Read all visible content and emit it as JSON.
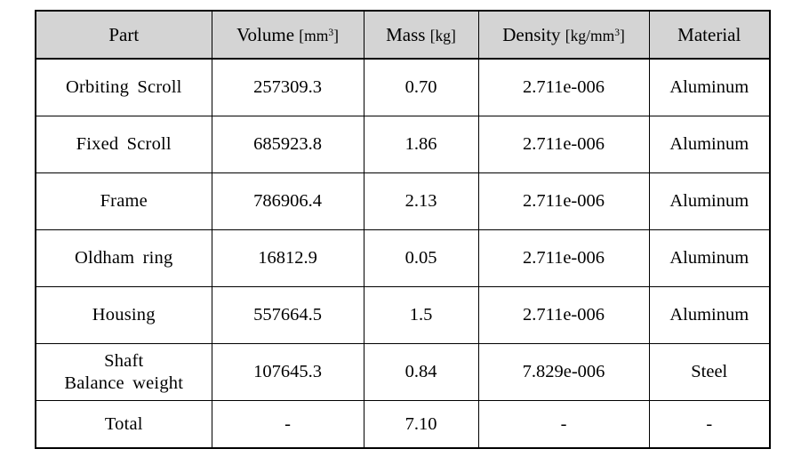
{
  "table": {
    "columns": [
      {
        "id": "part",
        "label": "Part",
        "unit": ""
      },
      {
        "id": "volume",
        "label": "Volume",
        "unit": "[mm³]"
      },
      {
        "id": "mass",
        "label": "Mass",
        "unit": "[kg]"
      },
      {
        "id": "density",
        "label": "Density",
        "unit": "[kg/mm³]"
      },
      {
        "id": "material",
        "label": "Material",
        "unit": ""
      }
    ],
    "header": {
      "part": "Part",
      "volume_label": "Volume",
      "volume_unit_open": "[",
      "volume_unit_base": "mm",
      "volume_unit_exp": "3",
      "volume_unit_close": "]",
      "mass_label": "Mass",
      "mass_unit": "[kg]",
      "density_label": "Density",
      "density_unit_open": "[kg/",
      "density_unit_base": "mm",
      "density_unit_exp": "3",
      "density_unit_close": "]",
      "material": "Material"
    },
    "rows": [
      {
        "part": "Orbiting  Scroll",
        "volume": "257309.3",
        "mass": "0.70",
        "density": "2.711e-006",
        "material": "Aluminum"
      },
      {
        "part": "Fixed  Scroll",
        "volume": "685923.8",
        "mass": "1.86",
        "density": "2.711e-006",
        "material": "Aluminum"
      },
      {
        "part": "Frame",
        "volume": "786906.4",
        "mass": "2.13",
        "density": "2.711e-006",
        "material": "Aluminum"
      },
      {
        "part": "Oldham  ring",
        "volume": "16812.9",
        "mass": "0.05",
        "density": "2.711e-006",
        "material": "Aluminum"
      },
      {
        "part": "Housing",
        "volume": "557664.5",
        "mass": "1.5",
        "density": "2.711e-006",
        "material": "Aluminum"
      },
      {
        "part_line1": "Shaft",
        "part_line2": "Balance  weight",
        "volume": "107645.3",
        "mass": "0.84",
        "density": "7.829e-006",
        "material": "Steel"
      },
      {
        "part": "Total",
        "volume": "-",
        "mass": "7.10",
        "density": "-",
        "material": "-"
      }
    ]
  },
  "colors": {
    "header_background": "#d4d4d4",
    "border": "#000000",
    "text": "#000000",
    "page_background": "#ffffff"
  }
}
